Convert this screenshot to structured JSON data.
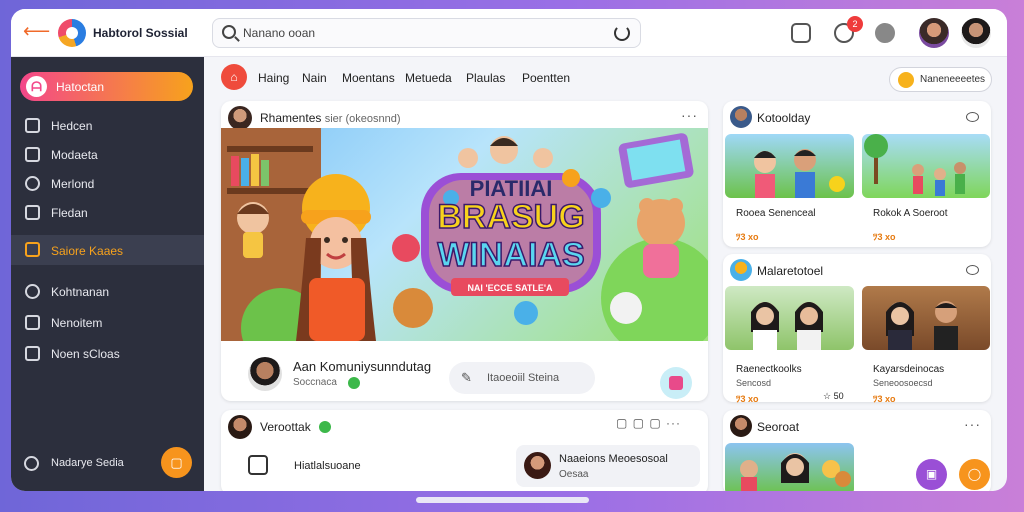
{
  "app": {
    "title": "Habtorol Sossial"
  },
  "search": {
    "value": "Nanano ooan"
  },
  "topbar": {
    "notification_count": "2"
  },
  "sidebar": {
    "active": "Hatoctan",
    "items": [
      "Hedcen",
      "Modaeta",
      "Merlond",
      "Fledan"
    ],
    "selected": "Saiore Kaaes",
    "items2": [
      "Kohtnanan",
      "Nenoitem",
      "Noen sCloas"
    ],
    "footer": "Nadarye Sedia"
  },
  "subnav": {
    "tabs": [
      "Haing",
      "Nain",
      "Moentans",
      "Metueda",
      "Plaulas",
      "Poentten"
    ],
    "pill": "Naneneeeetes"
  },
  "post": {
    "author": "Rhamentes",
    "meta": "sier (okeosnnd)",
    "art_lines": [
      "PIATIIAI",
      "BRASUG",
      "WINAIAS"
    ],
    "art_banner": "NAI 'ECCE SATLE'A",
    "footer_title": "Aan Komuniysunndutag",
    "footer_sub": "Soccnaca",
    "comment_placeholder": "Itaoeoiil Steina"
  },
  "post2": {
    "author": "Veroottak",
    "item_left": "Hiatlalsuoane",
    "item_right_title": "Naaeions Meoesosoal",
    "item_right_sub": "Oesaa"
  },
  "right": {
    "card1": {
      "title": "Kotoolday",
      "t1": "Rooea Senenceal",
      "v1": "ﾂ3 xo",
      "t2": "Rokok A Soeroot",
      "v2": "ﾂ3 xo"
    },
    "card2": {
      "title": "Malaretotoel",
      "t1": "Raenectkoolks",
      "s1": "Sencosd",
      "v1": "ﾂ3 xo",
      "v1b": "☆ 50",
      "t2": "Kayarsdeinocas",
      "s2": "Seneoosoecsd",
      "v2": "ﾂ3 xo"
    },
    "card3": {
      "title": "Seoroat"
    }
  },
  "colors": {
    "accent": "#f7941d",
    "pink": "#f3478a",
    "sidebar": "#2c2f3d"
  }
}
